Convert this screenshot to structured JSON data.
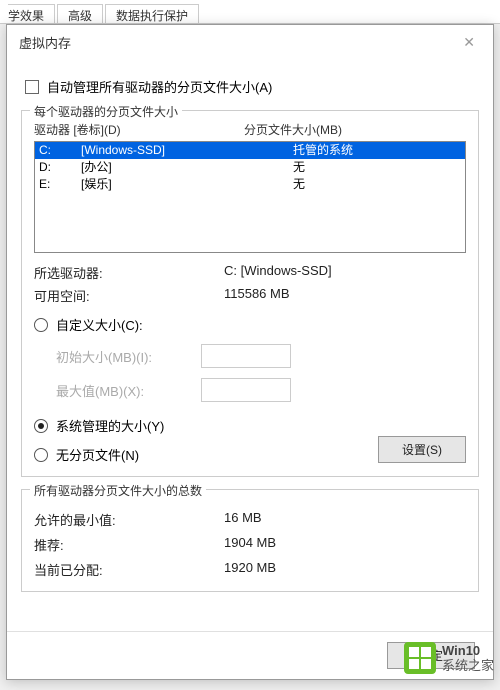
{
  "tabs": {
    "t1": "学效果",
    "t2": "高级",
    "t3": "数据执行保护"
  },
  "dialog": {
    "title": "虚拟内存"
  },
  "autoManage": {
    "label": "自动管理所有驱动器的分页文件大小(A)"
  },
  "group1": {
    "caption": "每个驱动器的分页文件大小",
    "header_drive": "驱动器 [卷标](D)",
    "header_size": "分页文件大小(MB)",
    "drives": [
      {
        "letter": "C:",
        "label": "[Windows-SSD]",
        "pf": "托管的系统"
      },
      {
        "letter": "D:",
        "label": "[办公]",
        "pf": "无"
      },
      {
        "letter": "E:",
        "label": "[娱乐]",
        "pf": "无"
      }
    ],
    "selected": {
      "key": "所选驱动器:",
      "val": "C:  [Windows-SSD]"
    },
    "free": {
      "key": "可用空间:",
      "val": "115586 MB"
    },
    "radio_custom": "自定义大小(C):",
    "initial": {
      "label": "初始大小(MB)(I):"
    },
    "maximum": {
      "label": "最大值(MB)(X):"
    },
    "radio_system": "系统管理的大小(Y)",
    "radio_none": "无分页文件(N)",
    "set_btn": "设置(S)"
  },
  "totals": {
    "caption": "所有驱动器分页文件大小的总数",
    "min": {
      "key": "允许的最小值:",
      "val": "16 MB"
    },
    "rec": {
      "key": "推荐:",
      "val": "1904 MB"
    },
    "cur": {
      "key": "当前已分配:",
      "val": "1920 MB"
    }
  },
  "buttons": {
    "ok": "确定"
  },
  "watermark": {
    "line1": "Win10",
    "line2": "系统之家"
  }
}
